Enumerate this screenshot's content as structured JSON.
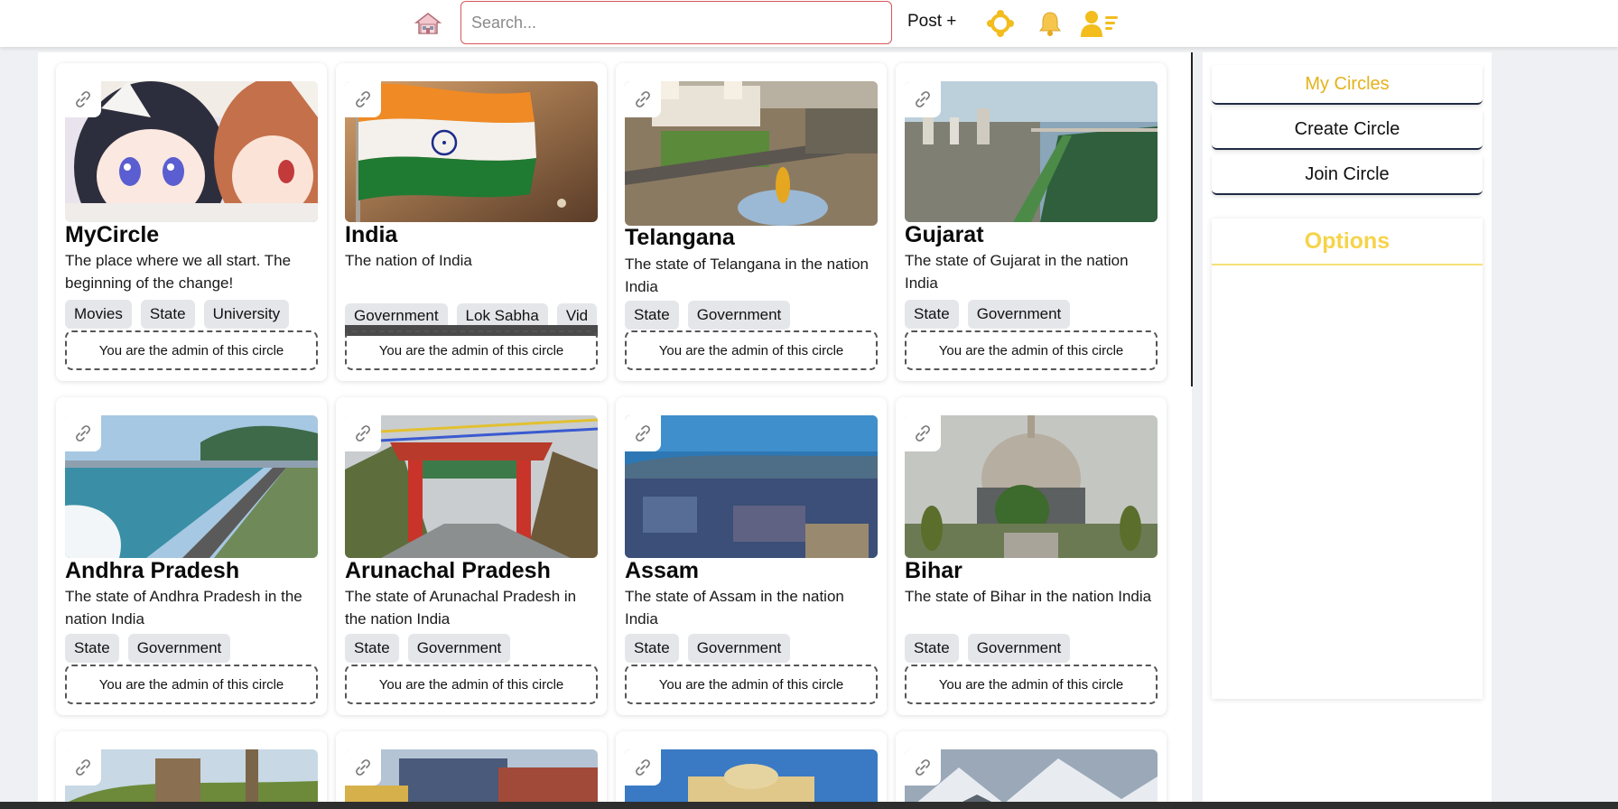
{
  "header": {
    "search_placeholder": "Search...",
    "post_label": "Post +"
  },
  "sidebar": {
    "buttons": [
      {
        "label": "My Circles",
        "active": true
      },
      {
        "label": "Create Circle",
        "active": false
      },
      {
        "label": "Join Circle",
        "active": false
      }
    ],
    "options_title": "Options"
  },
  "colors": {
    "accent_yellow": "#e3b21c",
    "search_border": "#d7565a",
    "tag_bg": "#e4e6ea"
  },
  "circles": [
    {
      "title": "MyCircle",
      "description": "The place where we all start. The beginning of the change!",
      "tags": [
        "Movies",
        "State",
        "University"
      ],
      "status": "You are the admin of this circle"
    },
    {
      "title": "India",
      "description": "The nation of India",
      "tags": [
        "Government",
        "Lok Sabha",
        "Vid"
      ],
      "status": "You are the admin of this circle"
    },
    {
      "title": "Telangana",
      "description": "The state of Telangana in the nation India",
      "tags": [
        "State",
        "Government"
      ],
      "status": "You are the admin of this circle"
    },
    {
      "title": "Gujarat",
      "description": "The state of Gujarat in the nation India",
      "tags": [
        "State",
        "Government"
      ],
      "status": "You are the admin of this circle"
    },
    {
      "title": "Andhra Pradesh",
      "description": "The state of Andhra Pradesh in the nation India",
      "tags": [
        "State",
        "Government"
      ],
      "status": "You are the admin of this circle"
    },
    {
      "title": "Arunachal Pradesh",
      "description": "The state of Arunachal Pradesh in the nation India",
      "tags": [
        "State",
        "Government"
      ],
      "status": "You are the admin of this circle"
    },
    {
      "title": "Assam",
      "description": "The state of Assam in the nation India",
      "tags": [
        "State",
        "Government"
      ],
      "status": "You are the admin of this circle"
    },
    {
      "title": "Bihar",
      "description": "The state of Bihar in the nation India",
      "tags": [
        "State",
        "Government"
      ],
      "status": "You are the admin of this circle"
    }
  ],
  "icons": {
    "home": "home-icon",
    "circles": "circles-icon",
    "notifications": "bell-icon",
    "profile": "user-menu-icon",
    "card_link": "link-icon"
  }
}
